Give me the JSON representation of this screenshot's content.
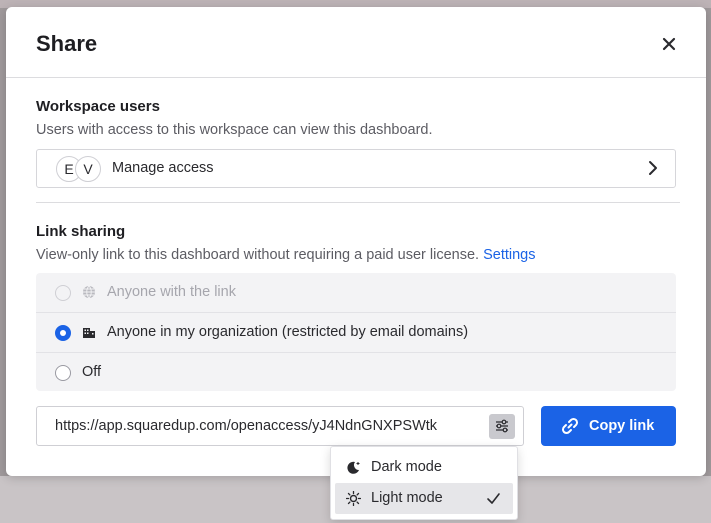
{
  "dialog": {
    "title": "Share",
    "close_label": "×"
  },
  "workspace_users": {
    "heading": "Workspace users",
    "description": "Users with access to this workspace can view this dashboard.",
    "avatars": [
      "E",
      "V"
    ],
    "manage_label": "Manage access"
  },
  "link_sharing": {
    "heading": "Link sharing",
    "description": "View-only link to this dashboard without requiring a paid user license.",
    "settings_link": "Settings",
    "options": [
      {
        "label": "Anyone with the link",
        "icon": "globe-icon",
        "state": "disabled"
      },
      {
        "label": "Anyone in my organization (restricted by email domains)",
        "icon": "building-icon",
        "state": "checked"
      },
      {
        "label": "Off",
        "icon": "",
        "state": "unchecked"
      }
    ],
    "url": "https://app.squaredup.com/openaccess/yJ4NdnGNXPSWtk",
    "copy_label": "Copy link"
  },
  "theme_menu": {
    "items": [
      {
        "label": "Dark mode",
        "icon": "moon-icon",
        "selected": false
      },
      {
        "label": "Light mode",
        "icon": "sun-icon",
        "selected": true
      }
    ]
  },
  "colors": {
    "accent": "#1b63e6",
    "backdrop": "#a09a9c",
    "menu_selected": "#e6e6e9"
  }
}
